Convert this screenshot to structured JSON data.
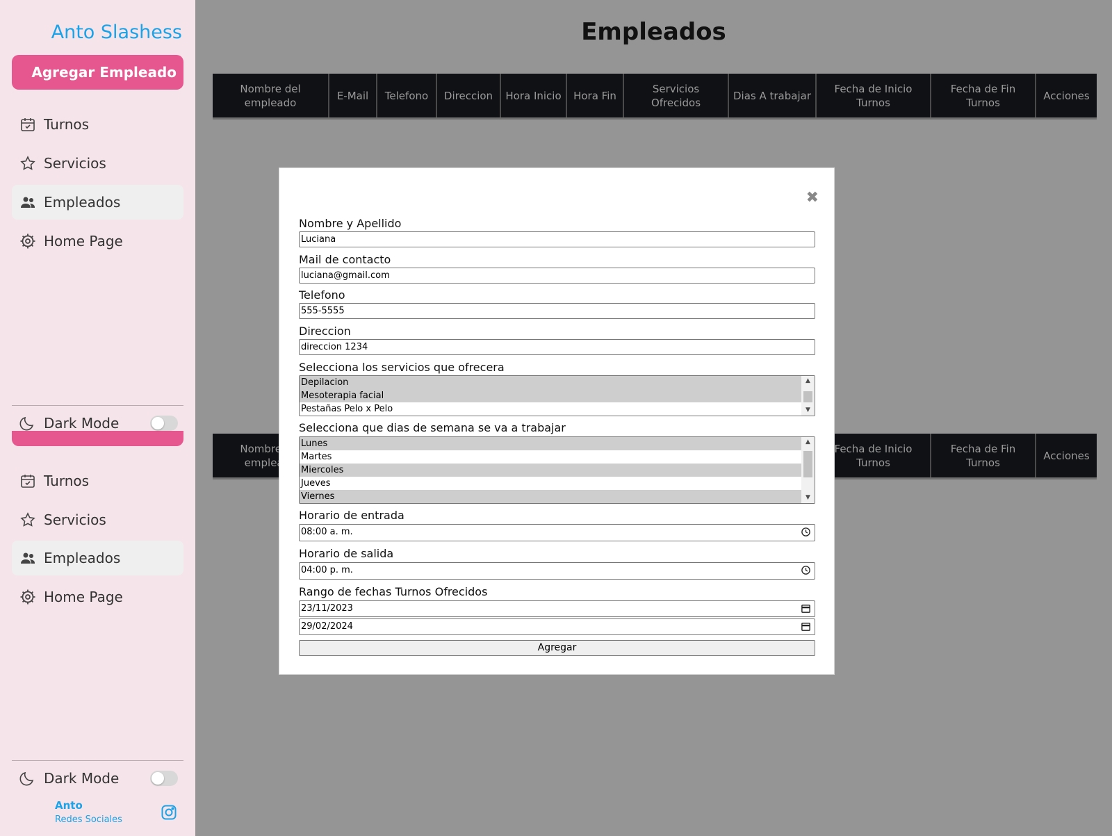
{
  "sidebar": {
    "brand": "Anto Slashess",
    "add_button": "Agregar Empleado",
    "nav": [
      {
        "label": "Turnos",
        "icon": "calendar-check-icon"
      },
      {
        "label": "Servicios",
        "icon": "star-icon"
      },
      {
        "label": "Empleados",
        "icon": "users-icon"
      },
      {
        "label": "Home Page",
        "icon": "gear-icon"
      }
    ],
    "dark_mode": "Dark Mode",
    "footer_name": "Anto",
    "footer_sub": "Redes Sociales",
    "accent": "#e6578f",
    "brand_color": "#1aa3e8"
  },
  "main": {
    "title": "Empleados",
    "columns": [
      "Nombre del empleado",
      "E-Mail",
      "Telefono",
      "Direccion",
      "Hora Inicio",
      "Hora Fin",
      "Servicios Ofrecidos",
      "Dias A trabajar",
      "Fecha de Inicio Turnos",
      "Fecha de Fin Turnos",
      "Acciones"
    ]
  },
  "modal": {
    "close": "✖",
    "name_label": "Nombre y Apellido",
    "name_value": "Luciana",
    "mail_label": "Mail de contacto",
    "mail_value": "luciana@gmail.com",
    "phone_label": "Telefono",
    "phone_value": "555-5555",
    "address_label": "Direccion",
    "address_value": "direccion 1234",
    "services_label": "Selecciona los servicios que ofrecera",
    "services": [
      {
        "label": "Depilacion",
        "selected": true
      },
      {
        "label": "Mesoterapia facial",
        "selected": true
      },
      {
        "label": "Pestañas Pelo x Pelo",
        "selected": false
      }
    ],
    "days_label": "Selecciona que dias de semana se va a trabajar",
    "days": [
      {
        "label": "Lunes",
        "selected": true
      },
      {
        "label": "Martes",
        "selected": false
      },
      {
        "label": "Miercoles",
        "selected": true
      },
      {
        "label": "Jueves",
        "selected": false
      },
      {
        "label": "Viernes",
        "selected": true
      }
    ],
    "start_label": "Horario de entrada",
    "start_value": "08:00 a. m.",
    "end_label": "Horario de salida",
    "end_value": "04:00 p. m.",
    "range_label": "Rango de fechas Turnos Ofrecidos",
    "date_from": "23/11/2023",
    "date_to": "29/02/2024",
    "submit": "Agregar"
  }
}
